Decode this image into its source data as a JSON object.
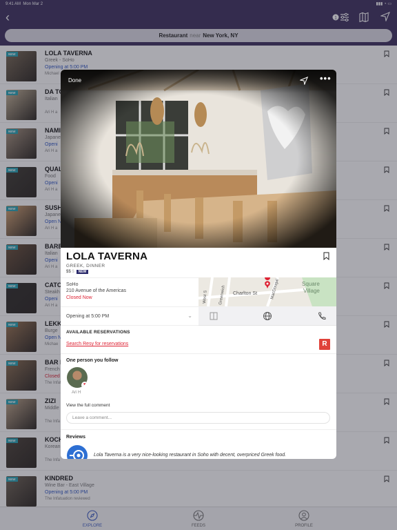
{
  "status_bar": {
    "time": "9:41 AM",
    "date": "Mon Mar 2"
  },
  "search": {
    "category": "Restaurant",
    "near_word": "near",
    "location": "New York, NY"
  },
  "header": {
    "filter_count": "1"
  },
  "badge_new": "NEW",
  "restaurants": [
    {
      "name": "LOLA TAVERNA",
      "sub": "Greek - SoHo",
      "status": "Opening at 5:00 PM",
      "reviewer": "Michael",
      "closed": false,
      "new": true
    },
    {
      "name": "DA TO",
      "sub": "Italian",
      "status": "",
      "reviewer": "Ari H a",
      "closed": false,
      "new": true
    },
    {
      "name": "NAMI",
      "sub": "Japane",
      "status": "Openi",
      "reviewer": "Ari H a",
      "closed": false,
      "new": true
    },
    {
      "name": "QUAL",
      "sub": "Food",
      "status": "Openi",
      "reviewer": "Ari H a",
      "closed": false,
      "new": true
    },
    {
      "name": "SUSH",
      "sub": "Japane",
      "status": "Open N",
      "reviewer": "Ari H a",
      "closed": false,
      "new": true
    },
    {
      "name": "BARB",
      "sub": "Italian",
      "status": "Openi",
      "reviewer": "Ari H a",
      "closed": false,
      "new": true
    },
    {
      "name": "CATC",
      "sub": "Steakh",
      "status": "Openi",
      "reviewer": "Ari H a",
      "closed": false,
      "new": true
    },
    {
      "name": "LEKK",
      "sub": "Burge",
      "status": "Open N",
      "reviewer": "Michae",
      "closed": false,
      "new": true
    },
    {
      "name": "BAR B",
      "sub": "French",
      "status": "Closed",
      "reviewer": "The Infatua",
      "closed": true,
      "new": true
    },
    {
      "name": "ZIZI",
      "sub": "Middle",
      "status": "",
      "reviewer": "The Infa",
      "closed": false,
      "new": true
    },
    {
      "name": "KOCH",
      "sub": "Korean",
      "status": "",
      "reviewer": "The Infa",
      "closed": false,
      "new": true
    },
    {
      "name": "KINDRED",
      "sub": "Wine Bar - East Village",
      "status": "Opening at 5:00 PM",
      "reviewer": "The Infatuation reviewed",
      "closed": false,
      "new": true
    }
  ],
  "tabs": [
    {
      "label": "EXPLORE",
      "icon": "compass-icon"
    },
    {
      "label": "FEEDS",
      "icon": "pulse-icon"
    },
    {
      "label": "PROFILE",
      "icon": "person-icon"
    }
  ],
  "detail": {
    "done_label": "Done",
    "name": "LOLA TAVERNA",
    "cuisine": "GREEK, DINNER",
    "price": "$$",
    "price_dim": "$",
    "new_tag": "NEW",
    "neighborhood": "SoHo",
    "address": "210 Avenue of the Americas",
    "open_status": "Closed Now",
    "hours": "Opening at 5:00 PM",
    "map_labels": {
      "street1": "Charlton St",
      "street2": "Greenwich",
      "street3": "MacDougal",
      "street4": "West S",
      "area": "Square",
      "area2": "Village"
    },
    "reservations_title": "AVAILABLE RESERVATIONS",
    "resy_link": "Search Resy for reservations",
    "resy_logo": "R",
    "follow_title": "One person you follow",
    "follower_name": "Ari H",
    "full_comment": "View the full comment",
    "comment_placeholder": "Leave a comment...",
    "reviews_title": "Reviews",
    "review_text": "Lola Taverna is a very nice-looking restaurant in Soho with decent, overpriced Greek food."
  },
  "colors": {
    "header": "#3c2f5e",
    "accent": "#3c5cc4",
    "closed": "#dd2233",
    "new_badge": "#27a3b5"
  }
}
